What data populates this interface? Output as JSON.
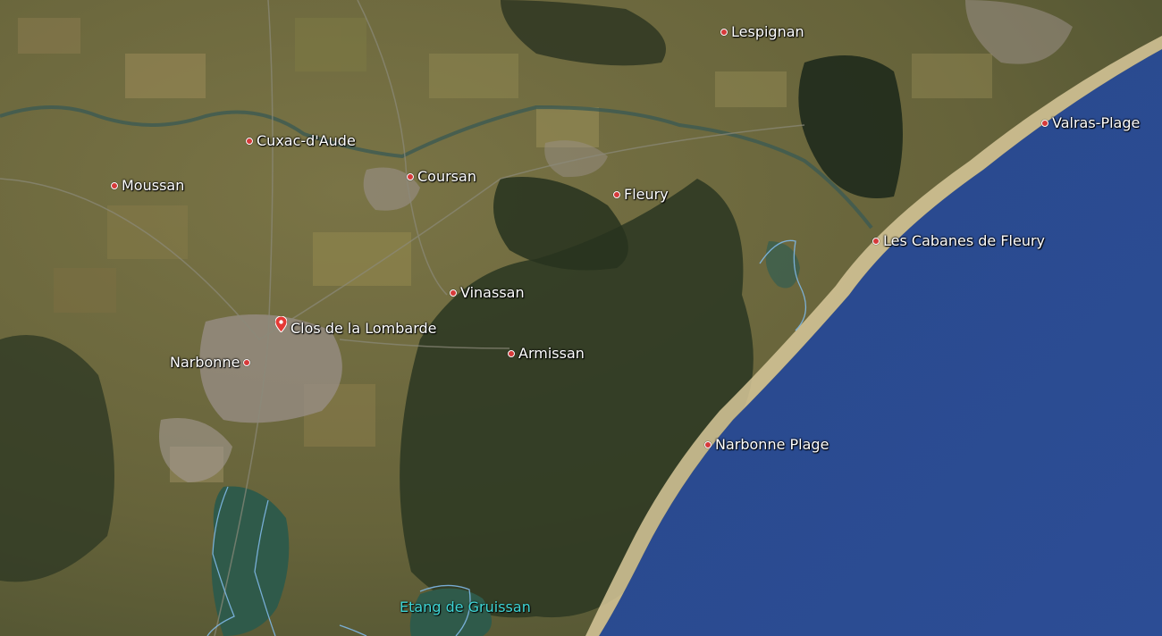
{
  "map": {
    "colors": {
      "sea_deep": "#2a4a8f",
      "sea_shallow": "#1f7a8a",
      "beach": "#d8c89a",
      "land": "#6b6a3e",
      "forest": "#2e3a22",
      "town": "#9a8f88",
      "lagoon": "#2f5a4a",
      "boundary": "#7fb8e6",
      "marker": "#d63a3a",
      "water_label": "#3fd6d6"
    },
    "places": [
      {
        "name": "Lespignan",
        "icon": "place-dot-icon"
      },
      {
        "name": "Valras-Plage",
        "icon": "place-dot-icon"
      },
      {
        "name": "Cuxac-d'Aude",
        "icon": "place-dot-icon"
      },
      {
        "name": "Coursan",
        "icon": "place-dot-icon"
      },
      {
        "name": "Moussan",
        "icon": "place-dot-icon"
      },
      {
        "name": "Fleury",
        "icon": "place-dot-icon"
      },
      {
        "name": "Les Cabanes de Fleury",
        "icon": "place-dot-icon"
      },
      {
        "name": "Vinassan",
        "icon": "place-dot-icon"
      },
      {
        "name": "Armissan",
        "icon": "place-dot-icon"
      },
      {
        "name": "Narbonne",
        "icon": "place-dot-icon"
      },
      {
        "name": "Narbonne Plage",
        "icon": "place-dot-icon"
      }
    ],
    "pin": {
      "name": "Clos de la Lombarde",
      "icon": "map-pin-icon"
    },
    "water": {
      "name": "Etang de Gruissan"
    }
  }
}
